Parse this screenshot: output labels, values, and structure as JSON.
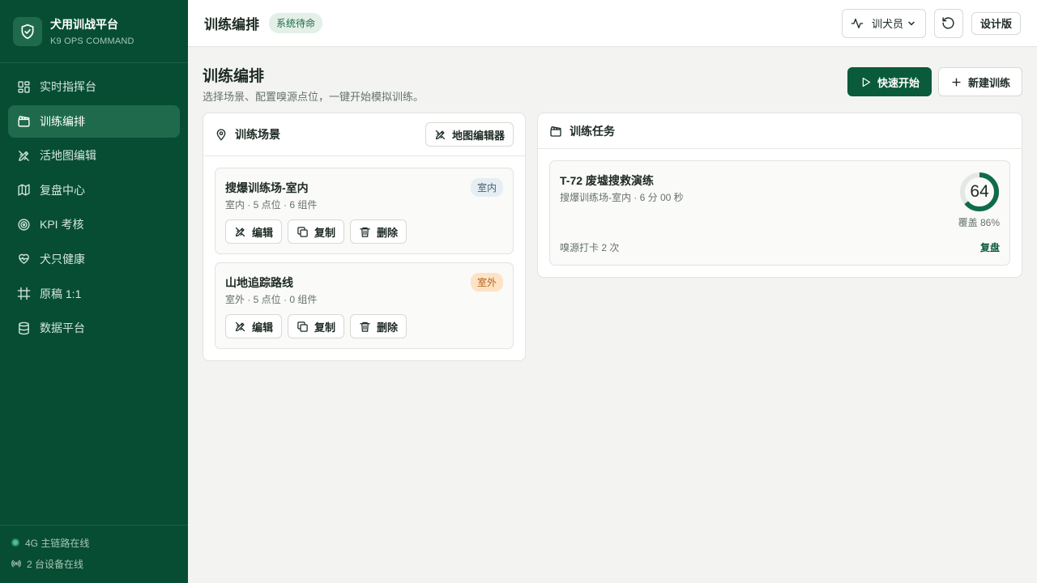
{
  "brand": {
    "title": "犬用训战平台",
    "subtitle": "K9 OPS COMMAND",
    "logo_icon": "shield-check-icon"
  },
  "sidebar": {
    "items": [
      {
        "label": "实时指挥台",
        "icon": "dashboard-grid-icon",
        "active": false
      },
      {
        "label": "训练编排",
        "icon": "clapperboard-icon",
        "active": true
      },
      {
        "label": "活地图编辑",
        "icon": "pen-ruler-icon",
        "active": false
      },
      {
        "label": "复盘中心",
        "icon": "map-icon",
        "active": false
      },
      {
        "label": "KPI 考核",
        "icon": "target-icon",
        "active": false
      },
      {
        "label": "犬只健康",
        "icon": "heart-pulse-icon",
        "active": false
      },
      {
        "label": "原稿 1:1",
        "icon": "frame-icon",
        "active": false
      },
      {
        "label": "数据平台",
        "icon": "database-icon",
        "active": false
      }
    ],
    "footer": {
      "link_status": "4G 主链路在线",
      "devices": "2 台设备在线"
    }
  },
  "topbar": {
    "title": "训练编排",
    "status": "系统待命",
    "role": "训犬员",
    "design_label": "设计版"
  },
  "page": {
    "title": "训练编排",
    "subtitle": "选择场景、配置嗅源点位，一键开始模拟训练。",
    "quick_start": "快速开始",
    "new_training": "新建训练"
  },
  "scenes_panel": {
    "title": "训练场景",
    "map_editor": "地图编辑器",
    "scenes": [
      {
        "name": "搜爆训练场-室内",
        "meta": "室内 · 5 点位 · 6 组件",
        "tag": "室内"
      },
      {
        "name": "山地追踪路线",
        "meta": "室外 · 5 点位 · 0 组件",
        "tag": "室外"
      }
    ],
    "actions": {
      "edit": "编辑",
      "copy": "复制",
      "delete": "删除"
    }
  },
  "tasks_panel": {
    "title": "训练任务",
    "tasks": [
      {
        "name": "T-72 废墟搜救演练",
        "meta": "搜爆训练场-室内 · 6 分 00 秒",
        "score": "64",
        "score_fraction": 0.64,
        "coverage": "覆盖 86%",
        "checkin": "嗅源打卡 2 次",
        "review": "复盘"
      }
    ]
  },
  "colors": {
    "sidebar_bg": "#064d34",
    "accent": "#0a5a3c",
    "active_item": "#1f6a4d",
    "outdoor_tag": "#fde2c4"
  }
}
